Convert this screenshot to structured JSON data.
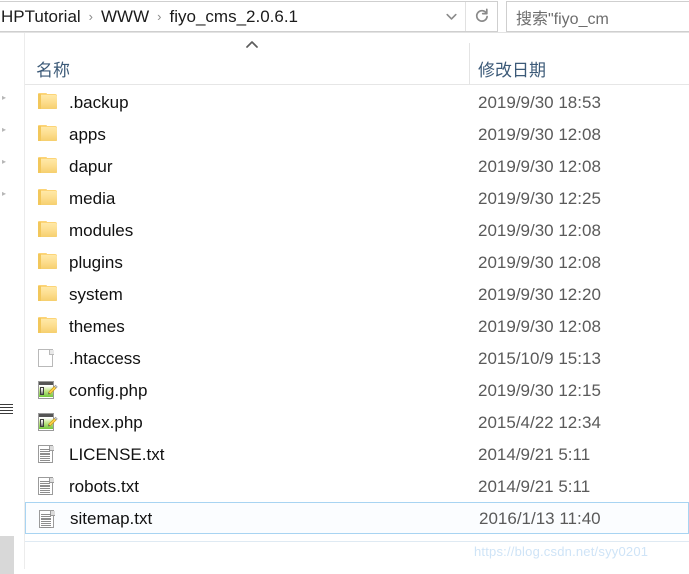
{
  "window": {
    "address": {
      "crumbs": [
        "HPTutorial",
        "WWW",
        "fiyo_cms_2.0.6.1"
      ],
      "separator": "›",
      "dropdown_icon": "chevron-down-icon",
      "refresh_icon": "refresh-icon"
    },
    "search": {
      "placeholder": "搜索\"fiyo_cm"
    }
  },
  "columns": {
    "name": "名称",
    "date_modified": "修改日期",
    "sort": "ascending"
  },
  "files": [
    {
      "name": ".backup",
      "date": "2019/9/30 18:53",
      "type": "folder",
      "icon": "folder-icon",
      "selected": false
    },
    {
      "name": "apps",
      "date": "2019/9/30 12:08",
      "type": "folder",
      "icon": "folder-icon",
      "selected": false
    },
    {
      "name": "dapur",
      "date": "2019/9/30 12:08",
      "type": "folder",
      "icon": "folder-icon",
      "selected": false
    },
    {
      "name": "media",
      "date": "2019/9/30 12:25",
      "type": "folder",
      "icon": "folder-icon",
      "selected": false
    },
    {
      "name": "modules",
      "date": "2019/9/30 12:08",
      "type": "folder",
      "icon": "folder-icon",
      "selected": false
    },
    {
      "name": "plugins",
      "date": "2019/9/30 12:08",
      "type": "folder",
      "icon": "folder-icon",
      "selected": false
    },
    {
      "name": "system",
      "date": "2019/9/30 12:20",
      "type": "folder",
      "icon": "folder-icon",
      "selected": false
    },
    {
      "name": "themes",
      "date": "2019/9/30 12:08",
      "type": "folder",
      "icon": "folder-icon",
      "selected": false
    },
    {
      "name": ".htaccess",
      "date": "2015/10/9 15:13",
      "type": "file",
      "icon": "blank-file-icon",
      "selected": false
    },
    {
      "name": "config.php",
      "date": "2019/9/30 12:15",
      "type": "file",
      "icon": "php-file-icon",
      "selected": false
    },
    {
      "name": "index.php",
      "date": "2015/4/22 12:34",
      "type": "file",
      "icon": "php-file-icon",
      "selected": false
    },
    {
      "name": "LICENSE.txt",
      "date": "2014/9/21 5:11",
      "type": "file",
      "icon": "text-file-icon",
      "selected": false
    },
    {
      "name": "robots.txt",
      "date": "2014/9/21 5:11",
      "type": "file",
      "icon": "text-file-icon",
      "selected": false
    },
    {
      "name": "sitemap.txt",
      "date": "2016/1/13 11:40",
      "type": "file",
      "icon": "text-file-icon",
      "selected": true
    }
  ],
  "watermark": "https://blog.csdn.net/syy0201",
  "colors": {
    "header_text": "#3c5a78",
    "row_text": "#111111",
    "date_text": "#5a5a5a",
    "selection_border": "#a8d4f2",
    "selection_fill": "#fbfdff",
    "folder": "#fcd477",
    "watermark": "#cfe4f7"
  }
}
